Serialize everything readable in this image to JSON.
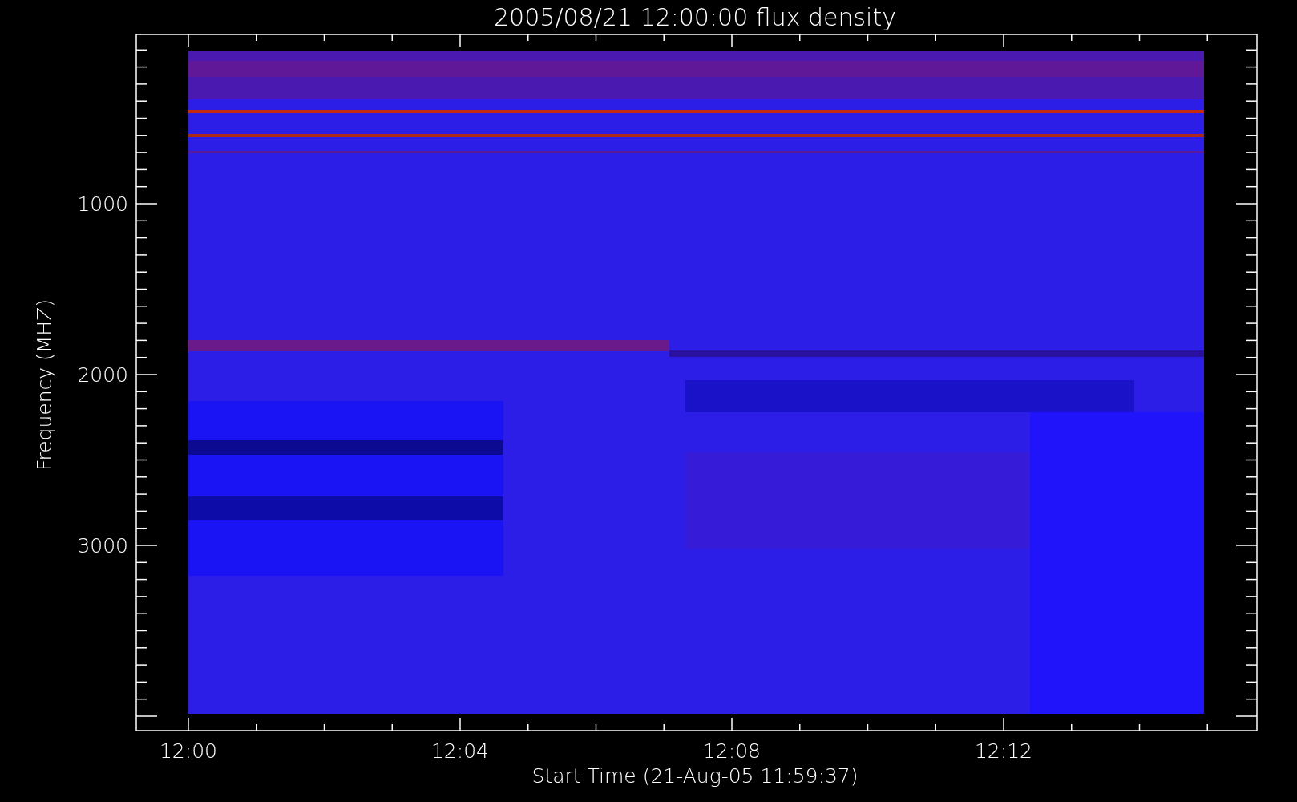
{
  "title": "2005/08/21 12:00:00 flux density",
  "y_axis": {
    "label": "Frequency (MHZ)",
    "tick_labels": [
      "1000",
      "2000",
      "3000"
    ]
  },
  "x_axis": {
    "label": "Start Time (21-Aug-05 11:59:37)",
    "tick_labels": [
      "12:00",
      "12:04",
      "12:08",
      "12:12"
    ]
  }
}
